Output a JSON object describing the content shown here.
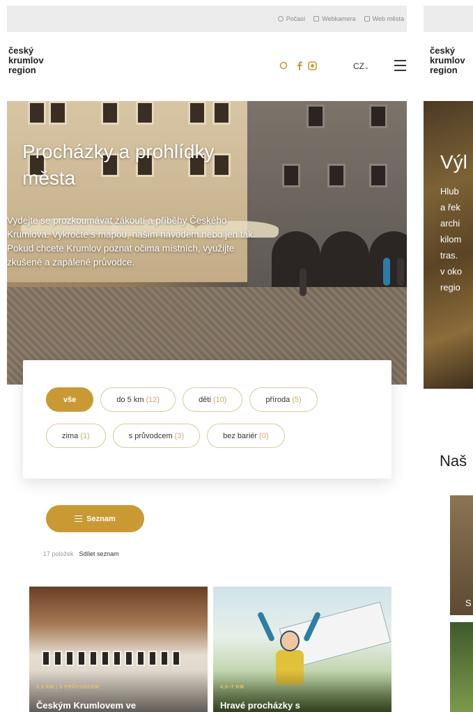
{
  "utility": {
    "links": [
      {
        "label": "Počasí",
        "icon": "sun-icon"
      },
      {
        "label": "Webkamera",
        "icon": "webcam-icon"
      },
      {
        "label": "Web města",
        "icon": "city-web-icon"
      }
    ]
  },
  "logo": {
    "line1": "český",
    "line2": "krumlov",
    "line3": "region"
  },
  "header": {
    "lang": "CZ",
    "icons": [
      "search-icon",
      "facebook-icon",
      "instagram-icon"
    ],
    "accent": "#c99a34"
  },
  "hero": {
    "title": "Procházky a prohlídky města",
    "text": "Vydejte se prozkoumávat zákoutí a příběhy Českého Krumlova. Vykročte s mapou, naším návodem nebo jen tak. Pokud chcete Krumlov poznat očima místních, využijte zkušené a zapálené průvodce."
  },
  "filters": {
    "row1": [
      {
        "label": "vše",
        "count": "",
        "active": true
      },
      {
        "label": "do 5 km",
        "count": "(12)",
        "active": false
      },
      {
        "label": "děti",
        "count": "(10)",
        "active": false
      },
      {
        "label": "příroda",
        "count": "(5)",
        "active": false
      }
    ],
    "row2": [
      {
        "label": "zima",
        "count": "(1)",
        "active": false
      },
      {
        "label": "s průvodcem",
        "count": "(3)",
        "active": false
      },
      {
        "label": "bez bariér",
        "count": "(0)",
        "active": false
      }
    ]
  },
  "list": {
    "button_label": "Seznam",
    "count_text": "17 položek",
    "share_label": "Sdílet seznam"
  },
  "cards": [
    {
      "kicker": "5,5 KM | S PRŮVODCEM",
      "title": "Českým Krumlovem ve"
    },
    {
      "kicker": "4,5–7 KM",
      "title": "Hravé procházky s"
    }
  ],
  "preview": {
    "logo": "český krumlov region",
    "hero_title": "Výl",
    "hero_text": "Hlub\na řek\narchi\nkilom\ntras.\nv oko\nregio",
    "section_title": "Naš",
    "thumb_letter": "S"
  }
}
